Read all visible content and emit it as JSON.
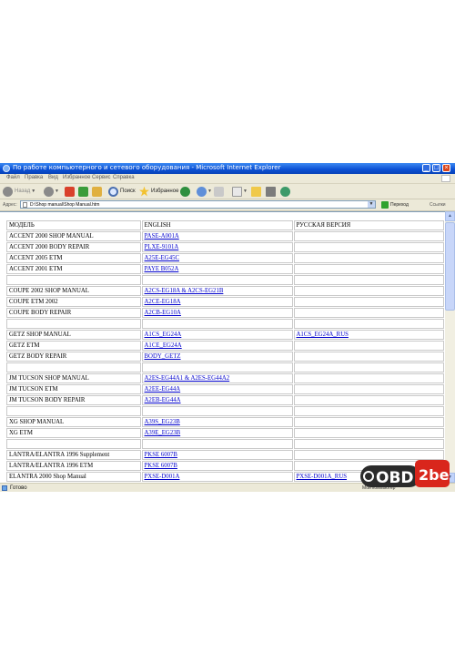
{
  "window": {
    "title": "По работе компьютерного и сетевого оборудования - Microsoft Internet Explorer",
    "min_label": "_",
    "max_label": "□",
    "close_label": "×"
  },
  "menu": [
    "Файл",
    "Правка",
    "Вид",
    "Избранное",
    "Сервис",
    "Справка"
  ],
  "toolbar": {
    "back_label": "Назад",
    "search_label": "Поиск",
    "favorites_label": "Избранное"
  },
  "address": {
    "label": "Адрес:",
    "value": "D:\\Shop manual\\Shop Manual.htm",
    "go_label": "Переход",
    "links_label": "Ссылки"
  },
  "table": {
    "headers": [
      "МОДЕЛЬ",
      "ENGLISH",
      "РУССКАЯ ВЕРСИЯ"
    ],
    "rows": [
      [
        "ACCENT 2000 SHOP MANUAL",
        "PASE-A001A",
        ""
      ],
      [
        "ACCENT 2000 BODY REPAIR",
        "PLXE-9101A",
        ""
      ],
      [
        "ACCENT 2005 ETM",
        "A25E-EG45C",
        ""
      ],
      [
        "ACCENT 2001 ETM",
        "PAYE B052A",
        ""
      ],
      [
        "",
        "",
        ""
      ],
      [
        "COUPE 2002 SHOP MANUAL",
        "A2CS-EG18A & A2CS-EG21B",
        ""
      ],
      [
        "COUPE ETM 2002",
        "A2CE-EG18A",
        ""
      ],
      [
        "COUPE BODY REPAIR",
        "A2CB-EG10A",
        ""
      ],
      [
        "",
        "",
        ""
      ],
      [
        "GETZ SHOP MANUAL",
        "A1CS_EG24A",
        "A1CS_EG24A_RUS"
      ],
      [
        "GETZ ETM",
        "A1CE_EG24A",
        ""
      ],
      [
        "GETZ BODY REPAIR",
        "BODY_GETZ",
        ""
      ],
      [
        "",
        "",
        ""
      ],
      [
        "JM TUCSON SHOP MANUAL",
        "A2ES-EG44A1 & A2ES-EG44A2",
        ""
      ],
      [
        "JM TUCSON ETM",
        "A2EE-EG44A",
        ""
      ],
      [
        "JM TUCSON BODY REPAIR",
        "A2EB-EG44A",
        ""
      ],
      [
        "",
        "",
        ""
      ],
      [
        "XG SHOP MANUAL",
        "A39S_EG23B",
        ""
      ],
      [
        "XG ETM",
        "A39E_EG23B",
        ""
      ],
      [
        "",
        "",
        ""
      ],
      [
        "LANTRA/ELANTRA 1996 Supplement",
        "PKSE 6007B",
        ""
      ],
      [
        "LANTRA/ELANTRA 1996 ETM",
        "PKSE 6007B",
        ""
      ],
      [
        "ELANTRA 2000 Shop Manual",
        "PXSE-D001A",
        "PXSE-D001A_RUS"
      ]
    ]
  },
  "status": {
    "text": "Готово",
    "zone": "Мой компьютер"
  },
  "watermark": {
    "text1": "OBD",
    "text2": "2be"
  }
}
